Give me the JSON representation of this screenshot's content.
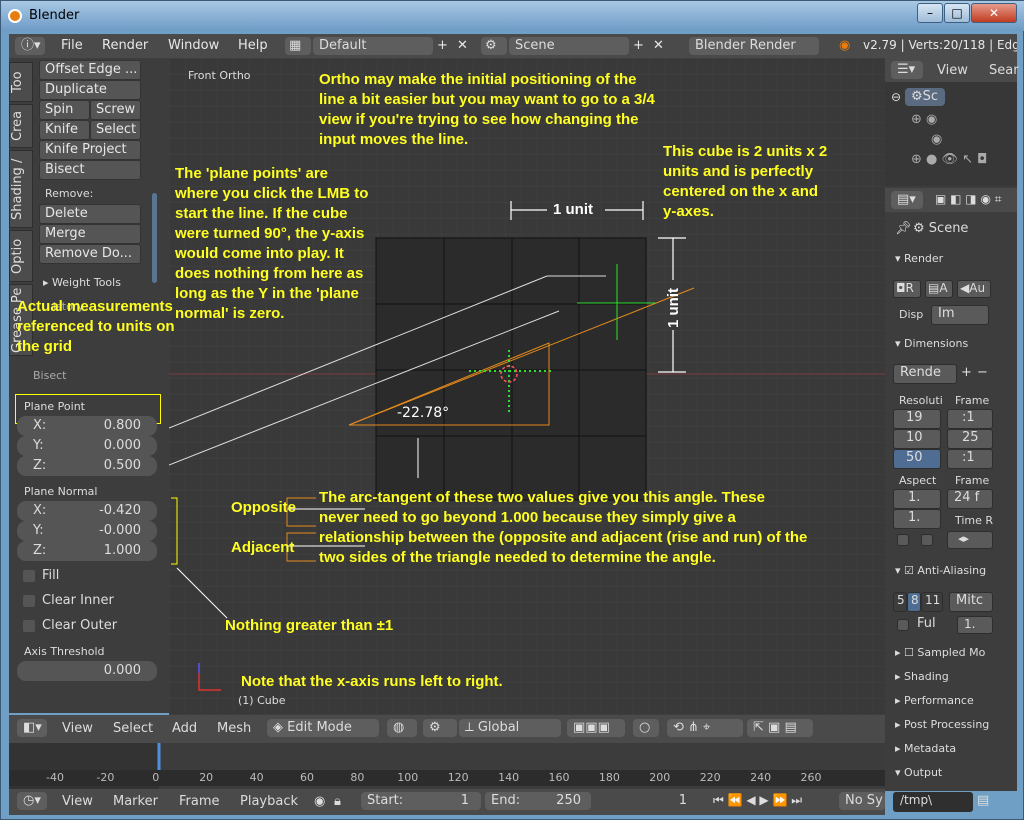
{
  "window": {
    "title": "Blender"
  },
  "menu": {
    "file": "File",
    "render": "Render",
    "window": "Window",
    "help": "Help",
    "layout": "Default",
    "scene": "Scene",
    "engine": "Blender Render",
    "stats": "v2.79 | Verts:20/118 | Edges:2"
  },
  "tools": {
    "tabs": [
      "Too",
      "Crea",
      "Shading /",
      "Optio",
      "Grease Pe"
    ],
    "offset_edge": "Offset Edge ...",
    "duplicate": "Duplicate",
    "spin": "Spin",
    "screw": "Screw",
    "knife": "Knife",
    "select": "Select",
    "knife_project": "Knife Project",
    "bisect": "Bisect",
    "remove": "Remove:",
    "delete": "Delete",
    "merge": "Merge",
    "remove_doubles": "Remove Do...",
    "weight_tools": "Weight Tools",
    "history": "istory",
    "bisect_panel": "Bisect"
  },
  "bisect": {
    "plane_point": "Plane Point",
    "px_label": "X:",
    "px": "0.800",
    "py_label": "Y:",
    "py": "0.000",
    "pz_label": "Z:",
    "pz": "0.500",
    "plane_normal": "Plane Normal",
    "nx_label": "X:",
    "nx": "-0.420",
    "ny_label": "Y:",
    "ny": "-0.000",
    "nz_label": "Z:",
    "nz": "1.000",
    "fill": "Fill",
    "clear_inner": "Clear Inner",
    "clear_outer": "Clear Outer",
    "axis_threshold": "Axis Threshold",
    "threshold": "0.000"
  },
  "viewport": {
    "view_name": "Front Ortho",
    "object": "(1) Cube",
    "angle": "-22.78°",
    "unit_h": "1 unit",
    "unit_v": "1 unit",
    "ann_ortho": "Ortho may make the initial positioning of the line a bit easier but you may want to go to a 3/4 view if you're trying to see how changing the input moves the line.",
    "ann_cube": "This cube is 2 units x 2 units and is perfectly centered on the x and y-axes.",
    "ann_plane": "The 'plane points' are where you click the LMB to start the line. If the cube were turned 90°, the y-axis would come into play. It does nothing from here as long as the Y in the 'plane normal' is zero.",
    "ann_actual": "Actual measurements referenced to units on the grid",
    "ann_opposite": "Opposite",
    "ann_adjacent": "Adjacent",
    "ann_arctan": "The arc-tangent of these two values give you this angle. These never need to go beyond 1.000 because they simply give a relationship between the (opposite and adjacent (rise and run) of the two sides of the triangle needed to determine the angle.",
    "ann_nothing": "Nothing greater than ±1",
    "ann_xaxis": "Note that the x-axis runs left to right."
  },
  "header3d": {
    "view": "View",
    "select": "Select",
    "add": "Add",
    "mesh": "Mesh",
    "mode": "Edit Mode",
    "orientation": "Global"
  },
  "timeline": {
    "ticks": [
      "-40",
      "-20",
      "0",
      "20",
      "40",
      "60",
      "80",
      "100",
      "120",
      "140",
      "160",
      "180",
      "200",
      "220",
      "240",
      "260"
    ]
  },
  "tlheader": {
    "view": "View",
    "marker": "Marker",
    "frame": "Frame",
    "playback": "Playback",
    "start_label": "Start:",
    "start": "1",
    "end_label": "End:",
    "end": "250",
    "current": "1",
    "sync": "No Sy"
  },
  "outliner": {
    "view": "View",
    "search": "Sear",
    "scene": "Sc"
  },
  "properties": {
    "scene": "Scene",
    "render": "Render",
    "r_btn": "R",
    "a_btn": "A",
    "au_btn": "Au",
    "disp": "Disp",
    "im": "Im",
    "dimensions": "Dimensions",
    "preset": "Rende",
    "resolution": "Resoluti",
    "frame": "Frame",
    "rx": "19",
    "ry": "10",
    "rp": "50",
    "fa": ":1",
    "fb": "25",
    "fc": ":1",
    "aspect": "Aspect",
    "ax": "1.",
    "ay": "1.",
    "frame2": "Frame",
    "fps": "24 f",
    "time_r": "Time R",
    "antialiasing": "Anti-Aliasing",
    "aa_5": "5",
    "aa_8": "8",
    "aa_11": "11",
    "mitc": "Mitc",
    "ful": "Ful",
    "ful_val": "1.",
    "sampled_motion": "Sampled Mo",
    "shading": "Shading",
    "performance": "Performance",
    "post_processing": "Post Processing",
    "metadata": "Metadata",
    "output": "Output",
    "path": "/tmp\\"
  }
}
